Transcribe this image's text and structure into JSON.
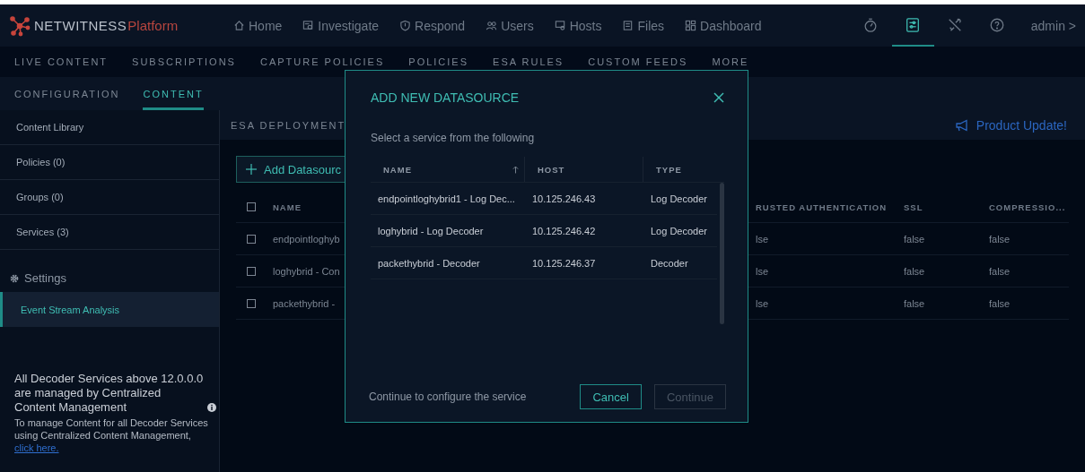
{
  "brand": {
    "name": "NETWITNESS",
    "suffix": "Platform"
  },
  "top_nav": [
    {
      "kind": "home",
      "label": "Home",
      "selected": false
    },
    {
      "kind": "investigate",
      "label": "Investigate",
      "selected": false
    },
    {
      "kind": "respond",
      "label": "Respond",
      "selected": false
    },
    {
      "kind": "users",
      "label": "Users",
      "selected": false
    },
    {
      "kind": "hosts",
      "label": "Hosts",
      "selected": false
    },
    {
      "kind": "files",
      "label": "Files",
      "selected": false
    },
    {
      "kind": "dashboard",
      "label": "Dashboard",
      "selected": false
    }
  ],
  "toolbar_icons": [
    {
      "kind": "timer",
      "selected": false
    },
    {
      "kind": "admin-panel",
      "selected": true
    },
    {
      "kind": "tools",
      "selected": false
    },
    {
      "kind": "help",
      "selected": false
    }
  ],
  "user": {
    "name": "admin",
    "caret": ">"
  },
  "sub_nav": [
    {
      "label": "LIVE CONTENT",
      "selected": false
    },
    {
      "label": "SUBSCRIPTIONS",
      "selected": false
    },
    {
      "label": "CAPTURE POLICIES",
      "selected": false
    },
    {
      "label": "POLICIES",
      "selected": false
    },
    {
      "label": "ESA RULES",
      "selected": false
    },
    {
      "label": "CUSTOM FEEDS",
      "selected": false
    },
    {
      "label": "MORE",
      "selected": false
    }
  ],
  "tabs": [
    {
      "label": "CONFIGURATION",
      "selected": false
    },
    {
      "label": "CONTENT",
      "selected": true
    }
  ],
  "sidebar": {
    "items": [
      {
        "label": "Content Library",
        "selected": false
      },
      {
        "label": "Policies (0)",
        "selected": false
      },
      {
        "label": "Groups (0)",
        "selected": false
      },
      {
        "label": "Services (3)",
        "selected": false
      }
    ],
    "settings_heading": "Settings",
    "settings_items": [
      {
        "label": "Event Stream Analysis",
        "selected": true
      }
    ],
    "notice": {
      "title": "All Decoder Services above 12.0.0.0 are managed by Centralized Content Management",
      "body": "To manage Content for all Decoder Services using Centralized Content Management,",
      "link": "click here."
    }
  },
  "main": {
    "header": "ESA DEPLOYMENT",
    "product_update": "Product Update!",
    "add_button": "Add Datasourc",
    "table": {
      "select_all_checked": false,
      "columns": [
        "NAME",
        "RUSTED AUTHENTICATION",
        "SSL",
        "COMPRESSIO..."
      ],
      "rows": [
        {
          "checked": false,
          "cells": [
            "endpointloghyb",
            "lse",
            "false",
            "false"
          ]
        },
        {
          "checked": false,
          "cells": [
            "loghybrid - Con",
            "lse",
            "false",
            "false"
          ]
        },
        {
          "checked": false,
          "cells": [
            "packethybrid -",
            "lse",
            "false",
            "false"
          ]
        }
      ]
    }
  },
  "modal": {
    "title": "ADD NEW DATASOURCE",
    "subtitle": "Select a service from the following",
    "columns": [
      {
        "label": "NAME",
        "sorted": true
      },
      {
        "label": "HOST",
        "sorted": false
      },
      {
        "label": "TYPE",
        "sorted": false
      }
    ],
    "rows": [
      {
        "selected": false,
        "cells": [
          "endpointloghybrid1 - Log Dec...",
          "10.125.246.43",
          "Log Decoder"
        ]
      },
      {
        "selected": false,
        "cells": [
          "loghybrid - Log Decoder",
          "10.125.246.42",
          "Log Decoder"
        ]
      },
      {
        "selected": false,
        "cells": [
          "packethybrid - Decoder",
          "10.125.246.37",
          "Decoder"
        ]
      }
    ],
    "footer_text": "Continue to configure the service",
    "buttons": [
      {
        "kind": "secondary",
        "label": "Cancel",
        "disabled": false
      },
      {
        "kind": "primary",
        "label": "Continue",
        "disabled": true
      }
    ]
  }
}
